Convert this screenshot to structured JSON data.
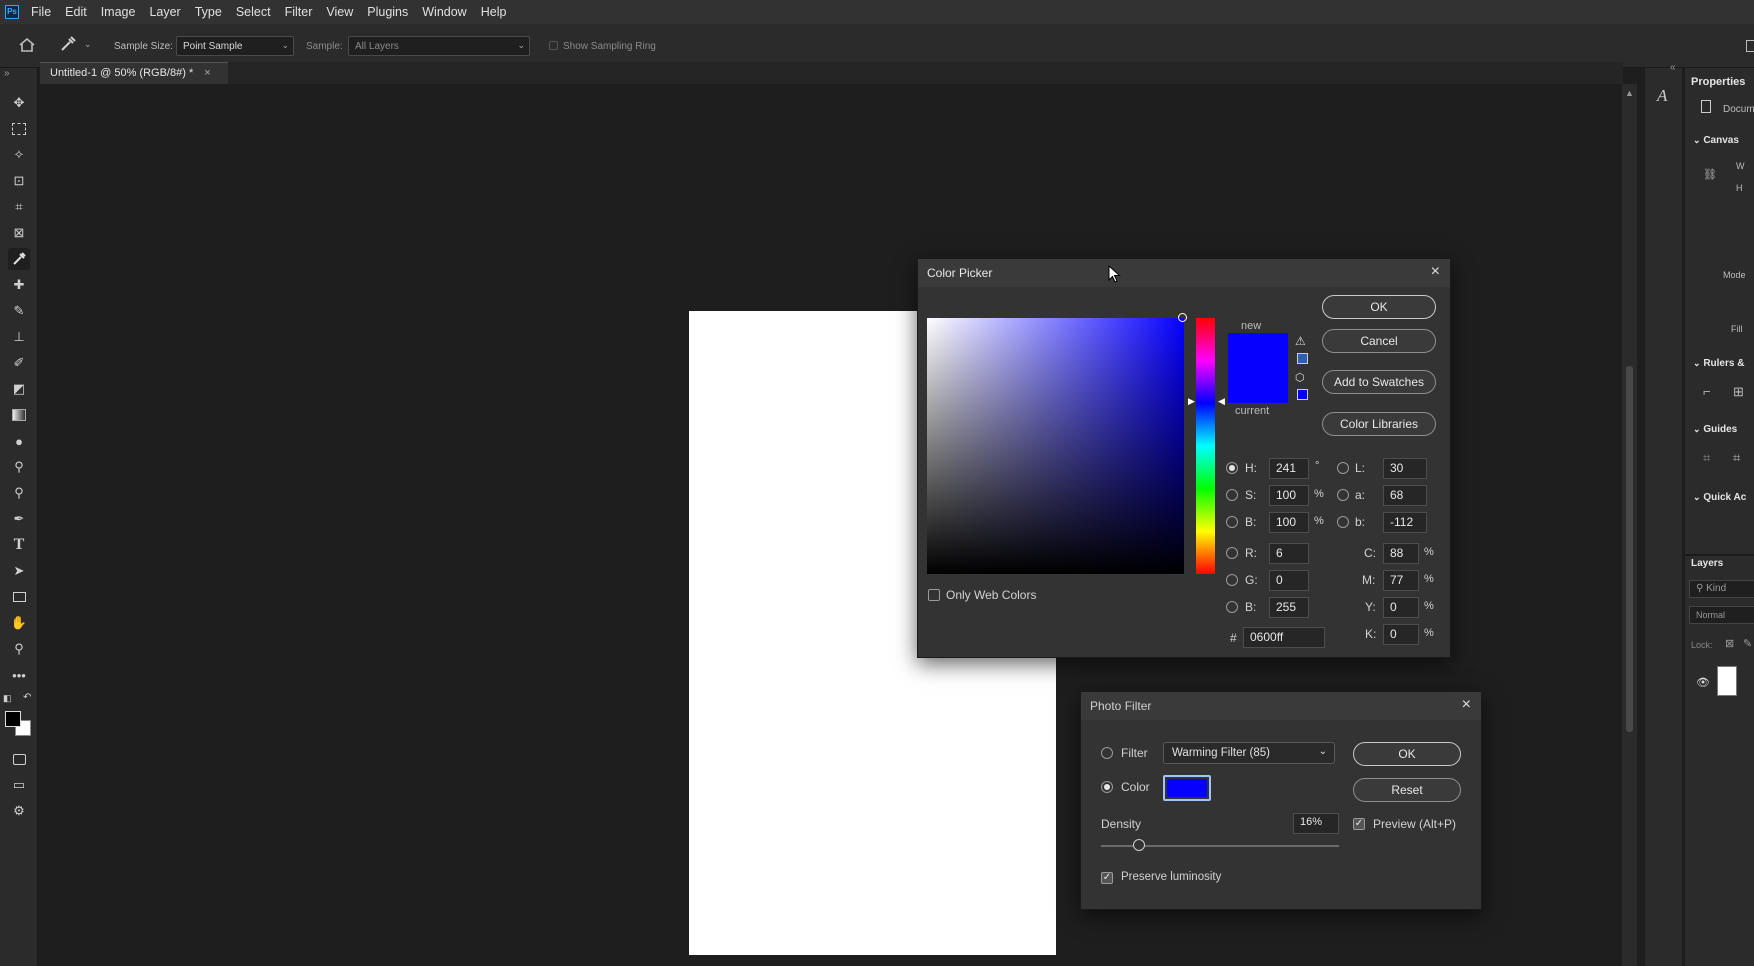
{
  "app": {
    "logo_text": "Ps"
  },
  "menu": [
    "File",
    "Edit",
    "Image",
    "Layer",
    "Type",
    "Select",
    "Filter",
    "View",
    "Plugins",
    "Window",
    "Help"
  ],
  "options_bar": {
    "sample_size_label": "Sample Size:",
    "sample_size_value": "Point Sample",
    "sample_label": "Sample:",
    "sample_value": "All Layers",
    "show_sampling_ring": "Show Sampling Ring"
  },
  "document_tab": {
    "title": "Untitled-1 @ 50% (RGB/8#) *",
    "close": "×"
  },
  "right_panel": {
    "properties": "Properties",
    "document": "Docum",
    "canvas": "Canvas",
    "w": "W",
    "h": "H",
    "mode": "Mode",
    "fill": "Fill",
    "rulers": "Rulers &",
    "guides": "Guides",
    "quick_actions": "Quick Ac",
    "layers": "Layers",
    "kind": "Kind",
    "blend_mode": "Normal",
    "lock": "Lock:"
  },
  "color_picker": {
    "title": "Color Picker",
    "close": "×",
    "ok": "OK",
    "cancel": "Cancel",
    "add_to_swatches": "Add to Swatches",
    "color_libraries": "Color Libraries",
    "new_label": "new",
    "current_label": "current",
    "new_color": "#0600ff",
    "current_color": "#0600ff",
    "only_web_colors": "Only Web Colors",
    "hsb": [
      {
        "label": "H:",
        "value": "241",
        "unit": "°",
        "selected": true
      },
      {
        "label": "S:",
        "value": "100",
        "unit": "%",
        "selected": false
      },
      {
        "label": "B:",
        "value": "100",
        "unit": "%",
        "selected": false
      }
    ],
    "lab": [
      {
        "label": "L:",
        "value": "30"
      },
      {
        "label": "a:",
        "value": "68"
      },
      {
        "label": "b:",
        "value": "-112"
      }
    ],
    "rgb": [
      {
        "label": "R:",
        "value": "6"
      },
      {
        "label": "G:",
        "value": "0"
      },
      {
        "label": "B:",
        "value": "255"
      }
    ],
    "cmyk": [
      {
        "label": "C:",
        "value": "88",
        "unit": "%"
      },
      {
        "label": "M:",
        "value": "77",
        "unit": "%"
      },
      {
        "label": "Y:",
        "value": "0",
        "unit": "%"
      },
      {
        "label": "K:",
        "value": "0",
        "unit": "%"
      }
    ],
    "hex_label": "#",
    "hex_value": "0600ff",
    "hue_color": "#0600ff"
  },
  "photo_filter": {
    "title": "Photo Filter",
    "close": "×",
    "filter_label": "Filter",
    "filter_value": "Warming Filter (85)",
    "color_label": "Color",
    "color_swatch": "#0600ff",
    "ok": "OK",
    "reset": "Reset",
    "density_label": "Density",
    "density_value": "16%",
    "density_fraction": 0.16,
    "preview_label": "Preview (Alt+P)",
    "preserve_luminosity": "Preserve luminosity"
  }
}
